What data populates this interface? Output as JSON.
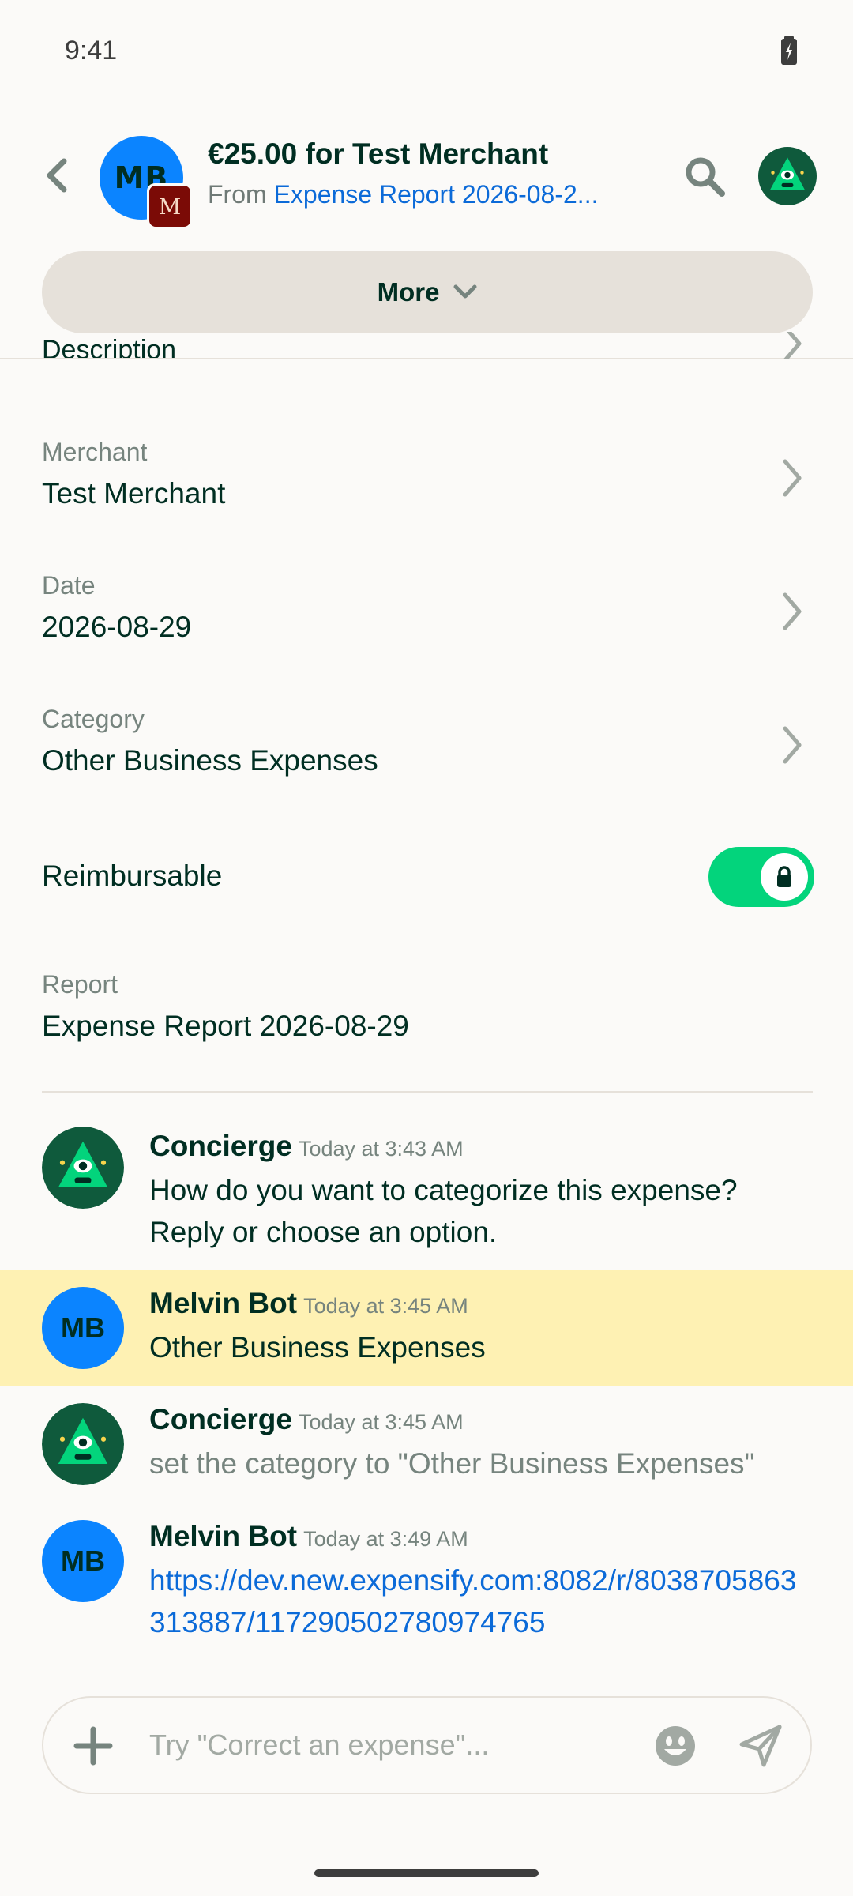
{
  "status": {
    "time": "9:41"
  },
  "header": {
    "avatar_initials": "MB",
    "workspace_initial": "M",
    "title": "€25.00 for Test Merchant",
    "from_label": "From",
    "report_link": "Expense Report 2026-08-2..."
  },
  "more_button": {
    "label": "More"
  },
  "fields": {
    "description_label": "Description",
    "merchant": {
      "label": "Merchant",
      "value": "Test Merchant"
    },
    "date": {
      "label": "Date",
      "value": "2026-08-29"
    },
    "category": {
      "label": "Category",
      "value": "Other Business Expenses"
    },
    "reimbursable": {
      "label": "Reimbursable",
      "enabled": true
    },
    "report": {
      "label": "Report",
      "value": "Expense Report 2026-08-29"
    }
  },
  "messages": [
    {
      "author": "Concierge",
      "time": "Today at 3:43 AM",
      "text": "How do you want to categorize this expense? Reply or choose an option."
    },
    {
      "author": "Melvin Bot",
      "initials": "MB",
      "time": "Today at 3:45 AM",
      "text": "Other Business Expenses"
    },
    {
      "author": "Concierge",
      "time": "Today at 3:45 AM",
      "text": "set the category to \"Other Business Expenses\""
    },
    {
      "author": "Melvin Bot",
      "initials": "MB",
      "time": "Today at 3:49 AM",
      "text": "https://dev.new.expensify.com:8082/r/8038705863313887/117290502780974765"
    }
  ],
  "composer": {
    "placeholder": "Try \"Correct an expense\"..."
  },
  "colors": {
    "accent_green": "#03D47C",
    "link_blue": "#0B6AD8",
    "avatar_blue": "#0B84FF",
    "highlight": "#FEF1B3",
    "text_dark": "#002E22",
    "text_muted": "#76847E"
  },
  "icons": [
    "back-arrow-icon",
    "search-icon",
    "concierge-icon",
    "chevron-down-icon",
    "chevron-right-icon",
    "lock-icon",
    "plus-icon",
    "emoji-icon",
    "send-icon",
    "battery-icon"
  ]
}
